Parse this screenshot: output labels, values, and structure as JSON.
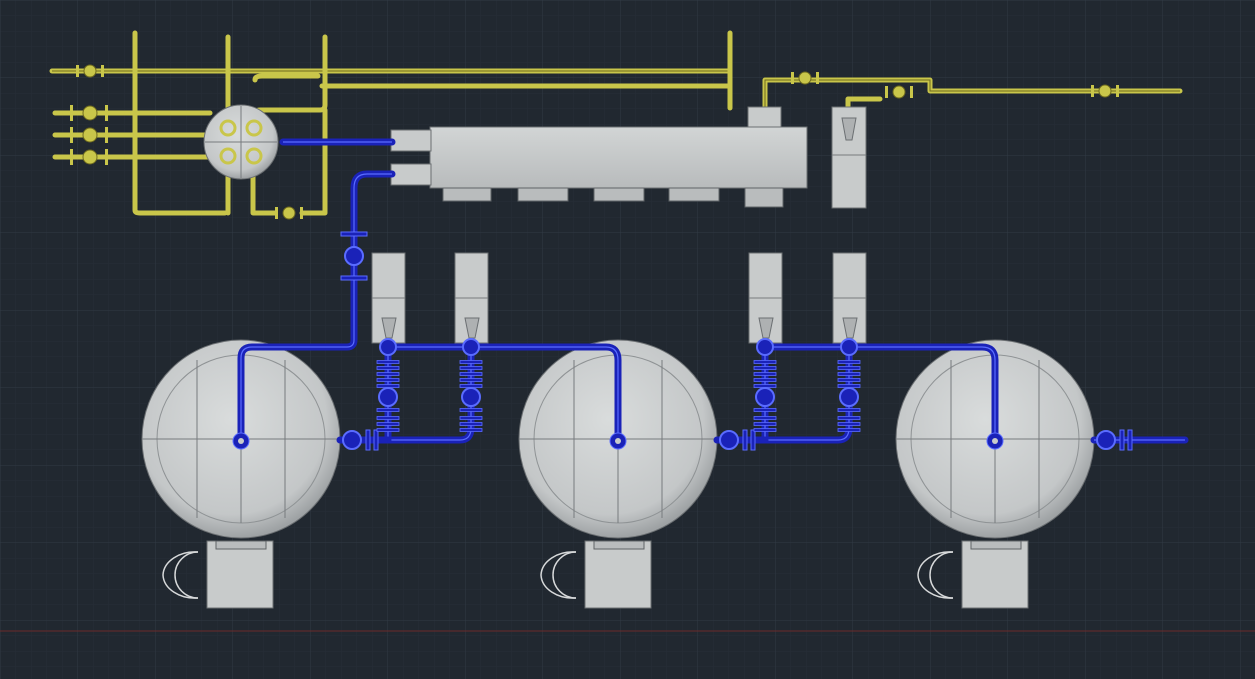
{
  "colors": {
    "background": "#212830",
    "grid_major": "#2e3640",
    "grid_minor": "#262d36",
    "yellow_piping": "#c9c64a",
    "blue_piping": "#1a22b8",
    "equipment_grey": "#c8cbcb",
    "axis_line": "#7a2a2a"
  },
  "diagram": {
    "view": "cad-3d-plan-view",
    "tanks": [
      {
        "name": "tank-1"
      },
      {
        "name": "tank-2"
      },
      {
        "name": "tank-3"
      }
    ],
    "equipment": [
      {
        "name": "header-box"
      },
      {
        "name": "distribution-drum"
      },
      {
        "name": "pump-unit-1"
      },
      {
        "name": "pump-unit-2"
      },
      {
        "name": "pump-unit-3"
      },
      {
        "name": "pump-unit-4"
      },
      {
        "name": "pump-unit-5"
      },
      {
        "name": "motor-base-1"
      },
      {
        "name": "motor-base-2"
      },
      {
        "name": "motor-base-3"
      }
    ]
  }
}
